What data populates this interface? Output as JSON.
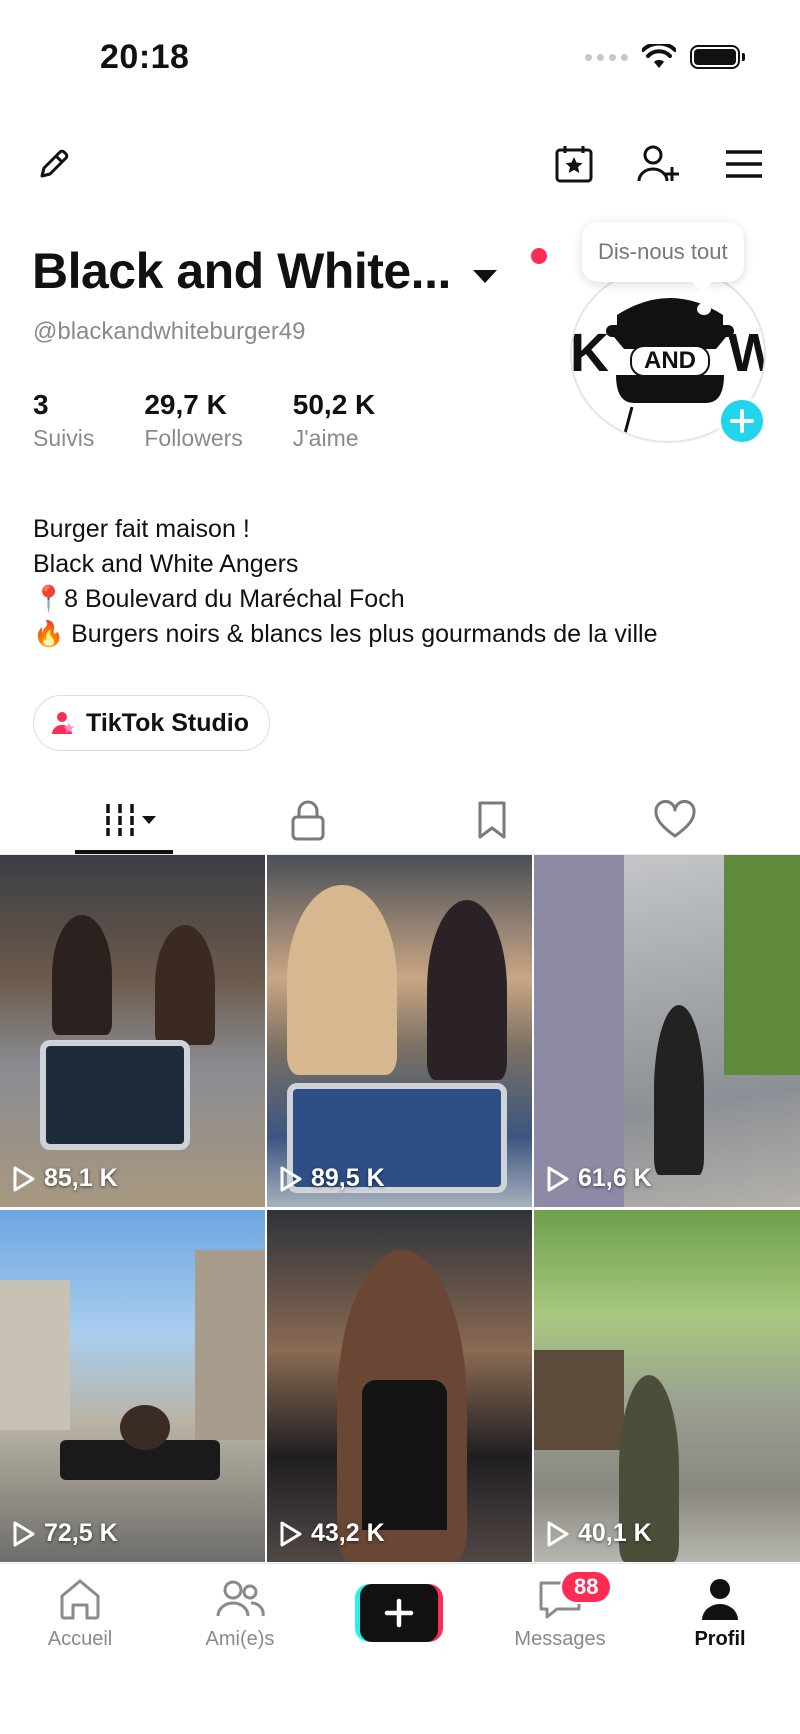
{
  "status_bar": {
    "time": "20:18"
  },
  "tooltip": "Dis-nous tout",
  "profile": {
    "name": "Black and White...",
    "username": "@blackandwhiteburger49",
    "avatar_text": "AND",
    "stats": [
      {
        "value": "3",
        "label": "Suivis"
      },
      {
        "value": "29,7 K",
        "label": "Followers"
      },
      {
        "value": "50,2 K",
        "label": "J'aime"
      }
    ],
    "bio": [
      "Burger fait maison !",
      "Black and White Angers",
      "📍8 Boulevard du Maréchal Foch",
      "🔥 Burgers noirs & blancs les plus gourmands de la ville"
    ]
  },
  "studio_button": "TikTok Studio",
  "tabs": [
    "videos-grid-icon",
    "lock-icon",
    "bookmark-icon",
    "heart-icon"
  ],
  "videos": [
    {
      "views": "85,1 K"
    },
    {
      "views": "89,5 K"
    },
    {
      "views": "61,6 K"
    },
    {
      "views": "72,5 K"
    },
    {
      "views": "43,2 K"
    },
    {
      "views": "40,1 K"
    }
  ],
  "bottom_nav": {
    "home": "Accueil",
    "friends": "Ami(e)s",
    "messages": "Messages",
    "messages_badge": "88",
    "profile": "Profil"
  },
  "colors": {
    "accent": "#fe2c55",
    "cyan": "#25f4ee",
    "plus_blue": "#20d5ec"
  }
}
